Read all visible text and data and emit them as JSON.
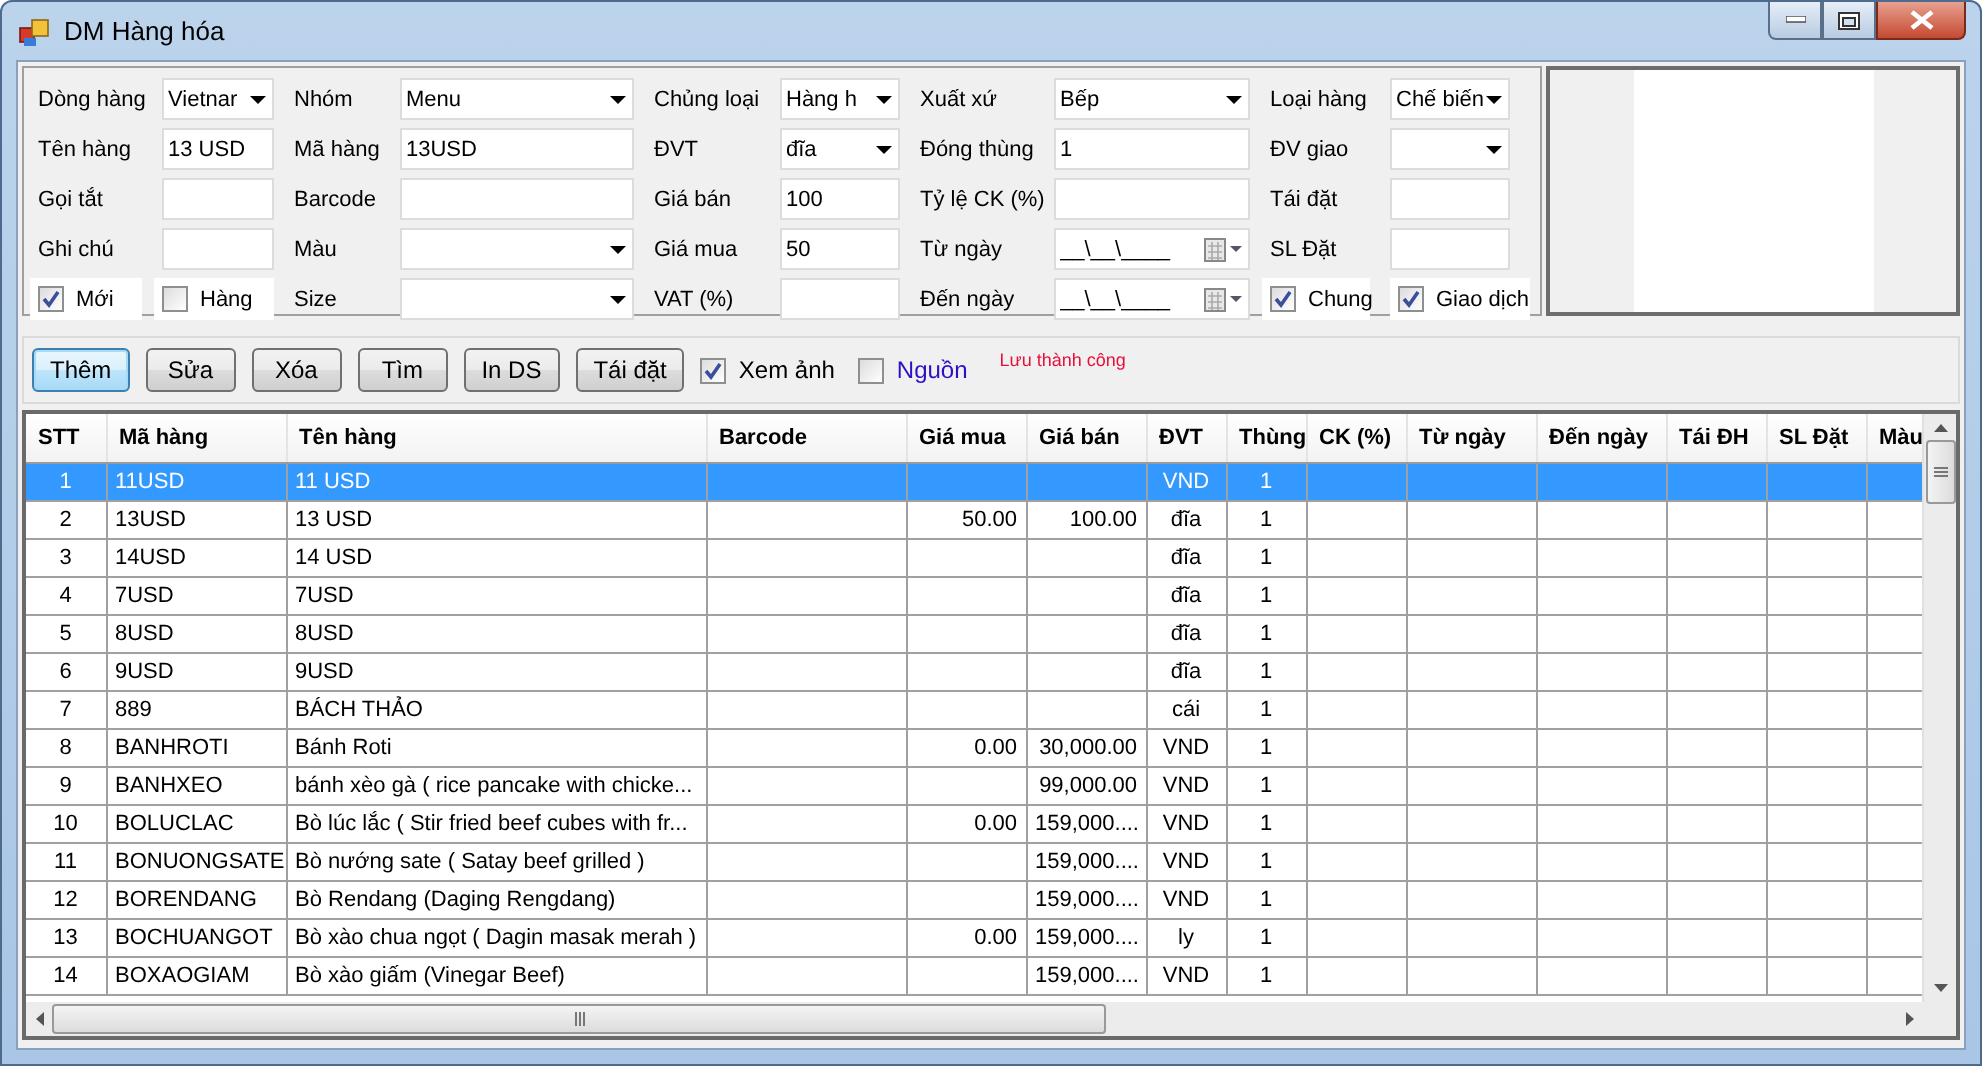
{
  "window": {
    "title": "DM Hàng hóa"
  },
  "form": {
    "rows": [
      [
        {
          "kind": "label",
          "text": "Dòng hàng"
        },
        {
          "kind": "combo",
          "value": "Vietnar"
        },
        {
          "kind": "label",
          "text": "Nhóm"
        },
        {
          "kind": "combo",
          "value": "Menu"
        },
        {
          "kind": "label",
          "text": "Chủng loại"
        },
        {
          "kind": "combo",
          "value": "Hàng h"
        },
        {
          "kind": "label",
          "text": "Xuất xứ"
        },
        {
          "kind": "combo",
          "value": "Bếp"
        },
        {
          "kind": "label",
          "text": "Loại hàng"
        },
        {
          "kind": "combo",
          "value": "Chế biến"
        }
      ],
      [
        {
          "kind": "label",
          "text": "Tên hàng"
        },
        {
          "kind": "text",
          "value": "13 USD"
        },
        {
          "kind": "label",
          "text": "Mã hàng"
        },
        {
          "kind": "text",
          "value": "13USD"
        },
        {
          "kind": "label",
          "text": "ĐVT"
        },
        {
          "kind": "combo",
          "value": "đĩa"
        },
        {
          "kind": "label",
          "text": "Đóng thùng"
        },
        {
          "kind": "text",
          "value": "1"
        },
        {
          "kind": "label",
          "text": "ĐV giao"
        },
        {
          "kind": "combo"
        }
      ],
      [
        {
          "kind": "label",
          "text": "Gọi tắt"
        },
        {
          "kind": "text"
        },
        {
          "kind": "label",
          "text": "Barcode"
        },
        {
          "kind": "text"
        },
        {
          "kind": "label",
          "text": "Giá bán"
        },
        {
          "kind": "text",
          "value": "100"
        },
        {
          "kind": "label",
          "text": "Tỷ lệ CK (%)"
        },
        {
          "kind": "text"
        },
        {
          "kind": "label",
          "text": "Tái đặt"
        },
        {
          "kind": "text"
        }
      ],
      [
        {
          "kind": "label",
          "text": "Ghi chú"
        },
        {
          "kind": "text"
        },
        {
          "kind": "label",
          "text": "Màu"
        },
        {
          "kind": "combo"
        },
        {
          "kind": "label",
          "text": "Giá mua"
        },
        {
          "kind": "text",
          "value": "50"
        },
        {
          "kind": "label",
          "text": "Từ ngày"
        },
        {
          "kind": "date",
          "value": "__\\__\\____"
        },
        {
          "kind": "label",
          "text": "SL Đặt"
        },
        {
          "kind": "text"
        }
      ],
      [
        {
          "kind": "check",
          "label": "Mới",
          "checked": true
        },
        {
          "kind": "check",
          "label": "Hàng",
          "checked": false
        },
        {
          "kind": "label",
          "text": "Size"
        },
        {
          "kind": "combo"
        },
        {
          "kind": "label",
          "text": "VAT (%)"
        },
        {
          "kind": "text"
        },
        {
          "kind": "label",
          "text": "Đến ngày"
        },
        {
          "kind": "date",
          "value": "__\\__\\____"
        },
        {
          "kind": "check",
          "label": "Chung",
          "checked": true
        },
        {
          "kind": "check",
          "label": "Giao dịch",
          "checked": true
        }
      ]
    ]
  },
  "toolbar": {
    "buttons": [
      {
        "label": "Thêm",
        "focused": true
      },
      {
        "label": "Sửa",
        "focused": false
      },
      {
        "label": "Xóa",
        "focused": false
      },
      {
        "label": "Tìm",
        "focused": false
      },
      {
        "label": "In DS",
        "focused": false
      },
      {
        "label": "Tái đặt",
        "focused": false
      }
    ],
    "checks": [
      {
        "label": "Xem ảnh",
        "checked": true,
        "color": "#000000"
      },
      {
        "label": "Nguồn",
        "checked": false,
        "color": "#2c10c8"
      }
    ],
    "status": "Lưu thành công"
  },
  "table": {
    "columns": [
      "STT",
      "Mã hàng",
      "Tên hàng",
      "Barcode",
      "Giá mua",
      "Giá bán",
      "ĐVT",
      "Thùng",
      "CK (%)",
      "Từ ngày",
      "Đến ngày",
      "Tái ĐH",
      "SL Đặt",
      "Màu"
    ],
    "rows": [
      {
        "selected": true,
        "cells": [
          "1",
          "11USD",
          "11 USD",
          null,
          null,
          null,
          "VND",
          "1",
          null,
          null,
          null,
          null,
          null,
          null
        ]
      },
      {
        "selected": false,
        "cells": [
          "2",
          "13USD",
          "13 USD",
          null,
          "50.00",
          "100.00",
          "đĩa",
          "1",
          null,
          null,
          null,
          null,
          null,
          null
        ]
      },
      {
        "selected": false,
        "cells": [
          "3",
          "14USD",
          "14 USD",
          null,
          null,
          null,
          "đĩa",
          "1",
          null,
          null,
          null,
          null,
          null,
          null
        ]
      },
      {
        "selected": false,
        "cells": [
          "4",
          "7USD",
          "7USD",
          null,
          null,
          null,
          "đĩa",
          "1",
          null,
          null,
          null,
          null,
          null,
          null
        ]
      },
      {
        "selected": false,
        "cells": [
          "5",
          "8USD",
          "8USD",
          null,
          null,
          null,
          "đĩa",
          "1",
          null,
          null,
          null,
          null,
          null,
          null
        ]
      },
      {
        "selected": false,
        "cells": [
          "6",
          "9USD",
          "9USD",
          null,
          null,
          null,
          "đĩa",
          "1",
          null,
          null,
          null,
          null,
          null,
          null
        ]
      },
      {
        "selected": false,
        "cells": [
          "7",
          "889",
          "BÁCH THẢO",
          null,
          null,
          null,
          "cái",
          "1",
          null,
          null,
          null,
          null,
          null,
          null
        ]
      },
      {
        "selected": false,
        "cells": [
          "8",
          "BANHROTI",
          "Bánh Roti",
          null,
          "0.00",
          "30,000.00",
          "VND",
          "1",
          null,
          null,
          null,
          null,
          null,
          null
        ]
      },
      {
        "selected": false,
        "cells": [
          "9",
          "BANHXEO",
          "bánh xèo gà ( rice pancake with chicke...",
          null,
          null,
          "99,000.00",
          "VND",
          "1",
          null,
          null,
          null,
          null,
          null,
          null
        ]
      },
      {
        "selected": false,
        "cells": [
          "10",
          "BOLUCLAC",
          "Bò lúc lắc ( Stir fried beef cubes with fr...",
          null,
          "0.00",
          "159,000....",
          "VND",
          "1",
          null,
          null,
          null,
          null,
          null,
          null
        ]
      },
      {
        "selected": false,
        "cells": [
          "11",
          "BONUONGSATE",
          "Bò nướng sate ( Satay beef grilled )",
          null,
          null,
          "159,000....",
          "VND",
          "1",
          null,
          null,
          null,
          null,
          null,
          null
        ]
      },
      {
        "selected": false,
        "cells": [
          "12",
          "BORENDANG",
          "Bò Rendang (Daging Rengdang)",
          null,
          null,
          "159,000....",
          "VND",
          "1",
          null,
          null,
          null,
          null,
          null,
          null
        ]
      },
      {
        "selected": false,
        "cells": [
          "13",
          "BOCHUANGOT",
          "Bò xào chua ngọt ( Dagin masak merah )",
          null,
          "0.00",
          "159,000....",
          "ly",
          "1",
          null,
          null,
          null,
          null,
          null,
          null
        ]
      },
      {
        "selected": false,
        "cells": [
          "14",
          "BOXAOGIAM",
          "Bò xào giấm (Vinegar Beef)",
          null,
          null,
          "159,000....",
          "VND",
          "1",
          null,
          null,
          null,
          null,
          null,
          null
        ]
      }
    ]
  }
}
